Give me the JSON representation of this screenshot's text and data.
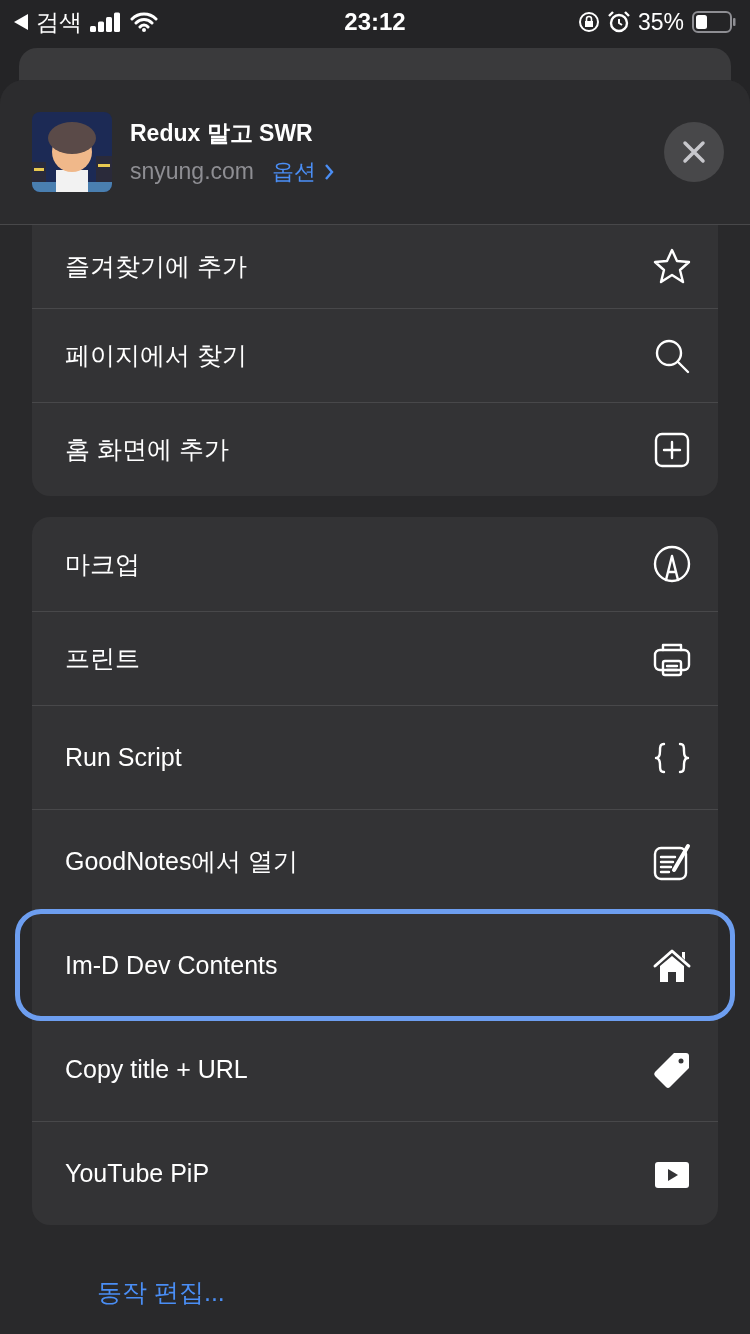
{
  "status_bar": {
    "back_label": "검색",
    "time": "23:12",
    "battery": "35%"
  },
  "page": {
    "title": "Redux 말고 SWR",
    "domain": "snyung.com",
    "options_link": "옵션"
  },
  "groups": [
    {
      "items": [
        {
          "label": "즐겨찾기에 추가",
          "selected": false
        },
        {
          "label": "페이지에서 찾기",
          "selected": false
        },
        {
          "label": "홈 화면에 추가",
          "selected": false
        }
      ]
    },
    {
      "items": [
        {
          "label": "마크업",
          "selected": false
        },
        {
          "label": "프린트",
          "selected": false
        },
        {
          "label": "Run Script",
          "selected": false
        },
        {
          "label": "GoodNotes에서 열기",
          "selected": false
        },
        {
          "label": "Im-D Dev Contents",
          "selected": true
        },
        {
          "label": "Copy title + URL",
          "selected": false
        },
        {
          "label": "YouTube PiP",
          "selected": false
        }
      ]
    }
  ],
  "edit_link": "동작 편집..."
}
